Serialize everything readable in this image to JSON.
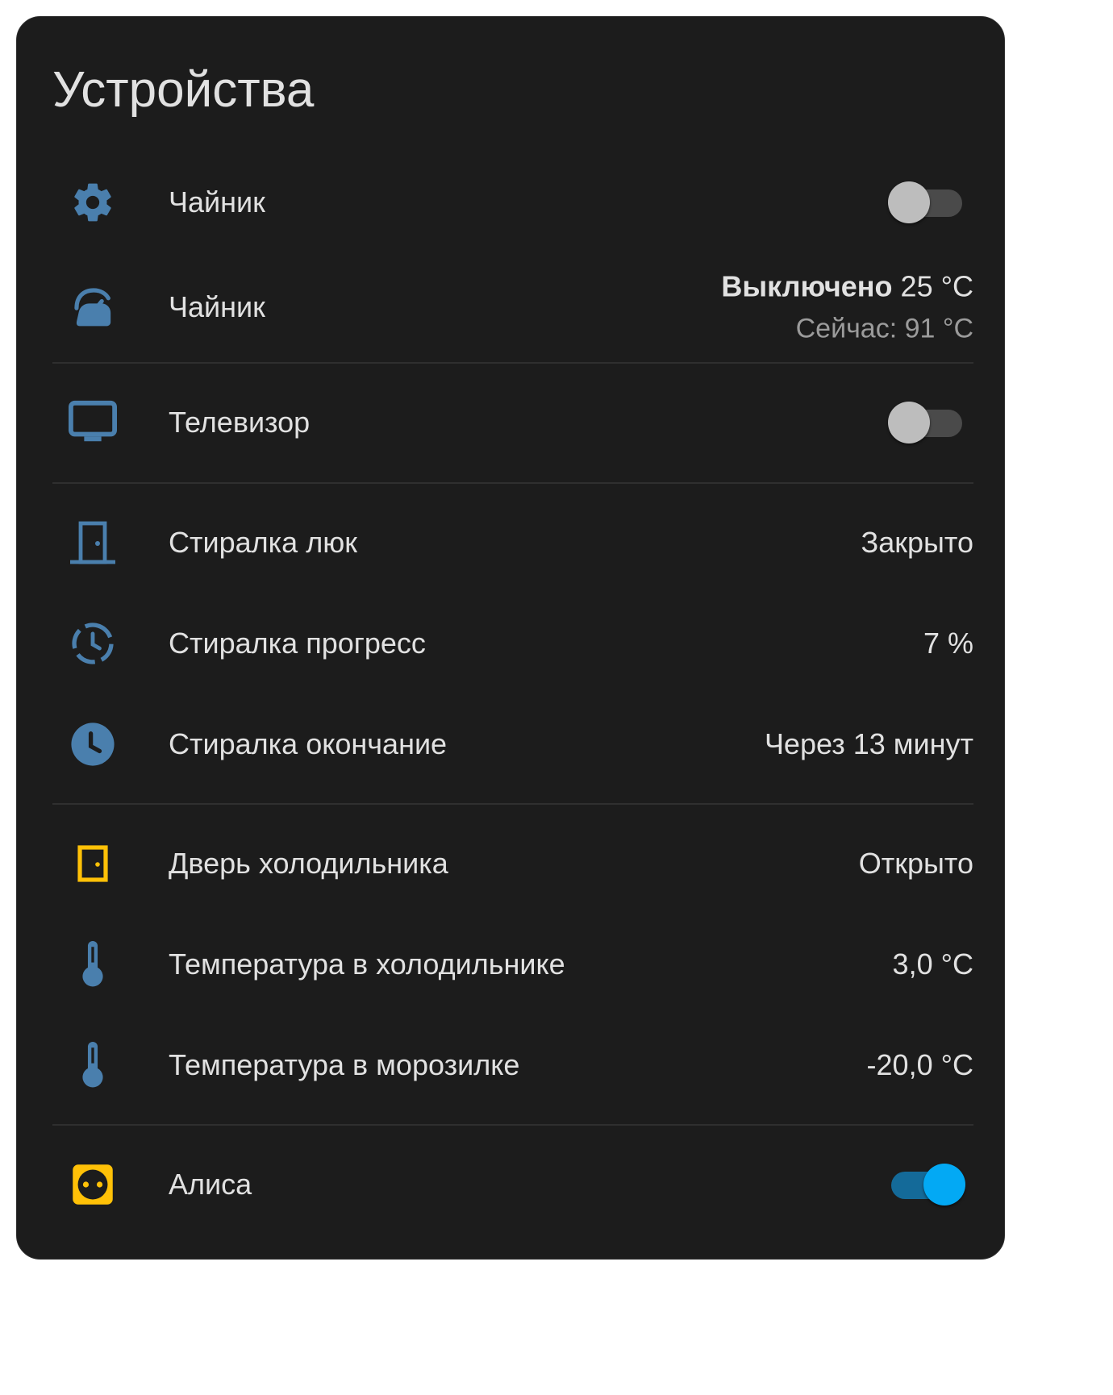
{
  "card": {
    "title": "Устройства",
    "accent_color": "#4a7fad",
    "active_color": "#ffc107",
    "rows": {
      "kettle_switch": {
        "name": "Чайник",
        "icon": "gear-icon",
        "state": "off"
      },
      "kettle_climate": {
        "name": "Чайник",
        "icon": "kettle-icon",
        "mode": "Выключено",
        "target": "25 °C",
        "current": "Сейчас: 91 °C"
      },
      "tv": {
        "name": "Телевизор",
        "icon": "television-icon",
        "state": "off"
      },
      "washer_door": {
        "name": "Стиралка люк",
        "icon": "door-closed-icon",
        "value": "Закрыто"
      },
      "washer_progress": {
        "name": "Стиралка прогресс",
        "icon": "progress-clock-icon",
        "value": "7 %"
      },
      "washer_end": {
        "name": "Стиралка окончание",
        "icon": "clock-icon",
        "value": "Через 13 минут"
      },
      "fridge_door": {
        "name": "Дверь холодильника",
        "icon": "door-open-icon",
        "value": "Открыто"
      },
      "fridge_temp": {
        "name": "Температура в холодильнике",
        "icon": "thermometer-icon",
        "value": "3,0 °C"
      },
      "freezer_temp": {
        "name": "Температура в морозилке",
        "icon": "thermometer-icon",
        "value": "-20,0 °C"
      },
      "alisa": {
        "name": "Алиса",
        "icon": "power-socket-icon",
        "state": "on"
      }
    }
  }
}
